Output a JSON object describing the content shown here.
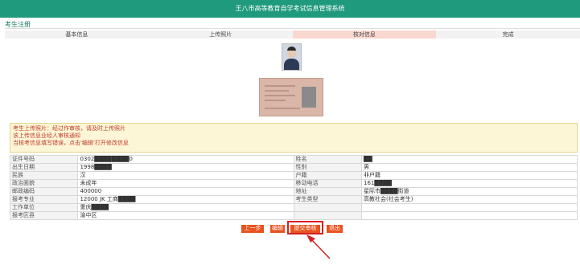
{
  "header": {
    "title": "王八市高等教育自学考试信息管理系统"
  },
  "section": {
    "title": "考生注册"
  },
  "steps": [
    "基本信息",
    "上传照片",
    "核对信息",
    "完成"
  ],
  "notice": {
    "lines": [
      "考生上传照片：经过作审核，请及时上传照片",
      "该上传信息业经人审核通知",
      "当核考信息填写错误，点击'编辑'打开修改信息"
    ]
  },
  "info": {
    "rows": [
      {
        "l1": "证件号码",
        "v1": "0302████████0",
        "l2": "姓名",
        "v2": "██"
      },
      {
        "l1": "出生日期",
        "v1": "1998████",
        "l2": "性别",
        "v2": "男"
      },
      {
        "l1": "民族",
        "v1": "汉",
        "l2": "户籍",
        "v2": "非户籍"
      },
      {
        "l1": "政治面貌",
        "v1": "未成年",
        "l2": "移动电话",
        "v2": "161████"
      },
      {
        "l1": "邮政编码",
        "v1": "400000",
        "l2": "地址",
        "v2": "星际市████街道"
      },
      {
        "l1": "报考专业",
        "v1": "12000 JK 工商████",
        "l2": "考生类型",
        "v2": "高教社会(社会考生)"
      },
      {
        "l1": "工作单位",
        "v1": "重庆████",
        "l2": "",
        "v2": ""
      },
      {
        "l1": "报考区县",
        "v1": "渝中区",
        "l2": "",
        "v2": ""
      }
    ]
  },
  "buttons": {
    "prev": "上一步",
    "edit": "编辑",
    "submit": "提交审核",
    "exit": "退出"
  },
  "colors": {
    "header": "#1f9a7c",
    "button": "#e8531f",
    "highlight": "#d62020"
  }
}
